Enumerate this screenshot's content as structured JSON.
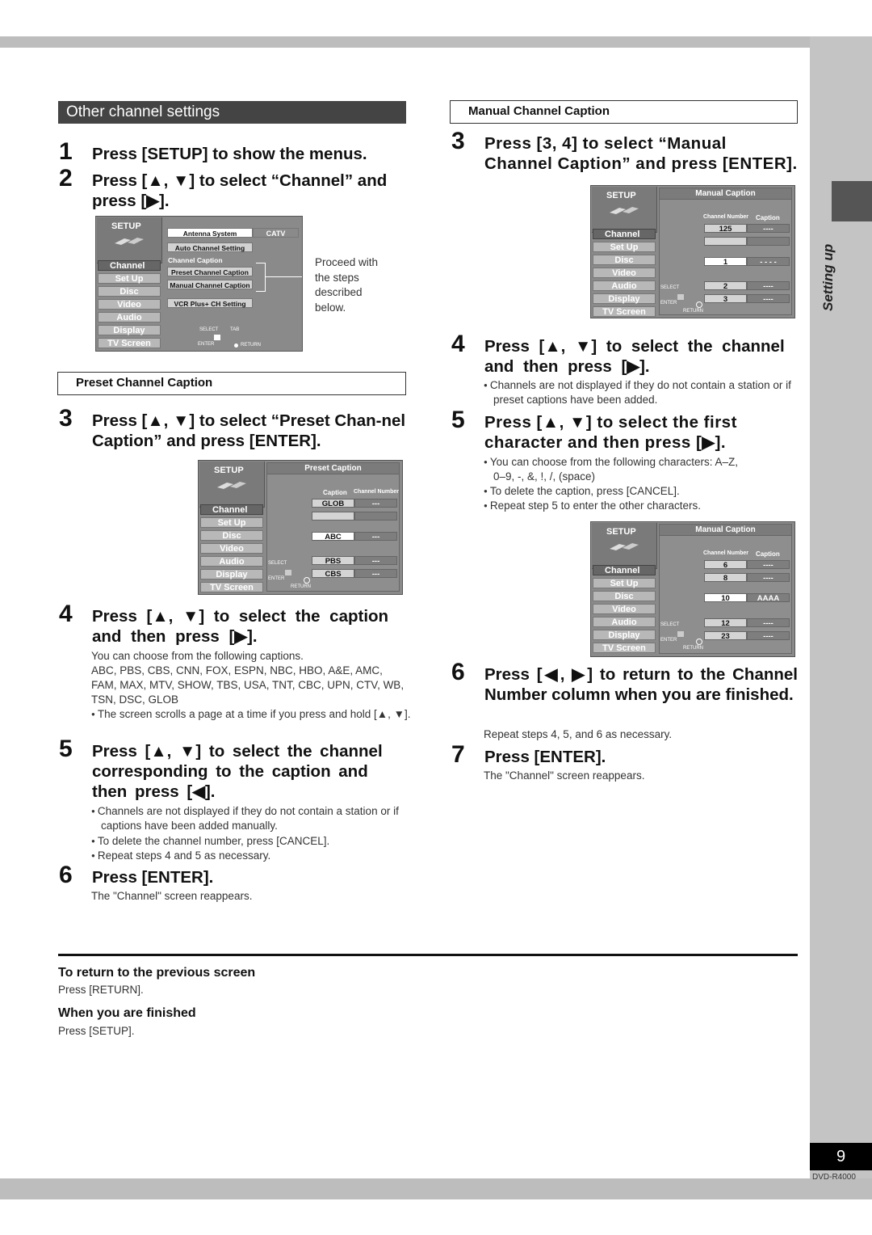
{
  "page": {
    "side_label": "Setting up",
    "page_number": "9",
    "model": "DVD-R4000"
  },
  "left": {
    "section_title": "Other channel settings",
    "steps_intro": [
      {
        "n": "1",
        "text": "Press [SETUP] to show the menus."
      },
      {
        "n": "2",
        "text": "Press [▲, ▼] to select “Channel” and press [▶]."
      }
    ],
    "proceed_note": "Proceed with the steps described below.",
    "preset_box": "Preset Channel Caption",
    "step3": {
      "n": "3",
      "text": "Press [▲, ▼] to select “Preset Chan-nel Caption” and press [ENTER]."
    },
    "step4": {
      "n": "4",
      "text": "Press [▲, ▼] to select the caption and then press [▶].",
      "lead": "You can choose from the following captions.",
      "captions": "ABC, PBS, CBS, CNN, FOX, ESPN, NBC, HBO, A&E, AMC, FAM, MAX, MTV, SHOW, TBS, USA, TNT, CBC, UPN, CTV, WB, TSN, DSC, GLOB",
      "bullet": "The screen scrolls a page at a time if you press and hold [▲, ▼]."
    },
    "step5": {
      "n": "5",
      "text": "Press [▲, ▼] to select the channel corresponding to the caption and then press [◀].",
      "bullets": [
        "Channels are not displayed if they do not contain a station or if captions have been added manually.",
        "To delete the channel number, press [CANCEL].",
        "Repeat steps 4 and 5 as necessary."
      ]
    },
    "step6": {
      "n": "6",
      "text": "Press [ENTER].",
      "note": "The \"Channel\" screen reappears."
    }
  },
  "right": {
    "manual_box": "Manual Channel Caption",
    "step3": {
      "n": "3",
      "text": "Press [3, 4] to select “Manual Channel Caption” and press [ENTER]."
    },
    "step4": {
      "n": "4",
      "text": "Press [▲, ▼] to select the channel and then press [▶].",
      "bullet": "Channels are not displayed if they do not contain a station or if preset captions have been added."
    },
    "step5": {
      "n": "5",
      "text": "Press [▲, ▼] to select the first character and then press [▶].",
      "bullets": [
        "You can choose from the following characters: A–Z, 0–9, -, &, !, /, (space)",
        "To delete the caption, press [CANCEL].",
        "Repeat step 5 to enter the other characters."
      ]
    },
    "step6": {
      "n": "6",
      "text": "Press [◀, ▶] to return to the Channel Number column when you are finished.",
      "note": "Repeat steps 4, 5, and 6 as necessary."
    },
    "step7": {
      "n": "7",
      "text": "Press [ENTER].",
      "note": "The \"Channel\" screen reappears."
    }
  },
  "footer": {
    "h1": "To return to the previous screen",
    "p1": "Press [RETURN].",
    "h2": "When you are finished",
    "p2": "Press [SETUP]."
  },
  "osd_common": {
    "setup": "SETUP",
    "menu": [
      "Channel",
      "Set Up",
      "Disc",
      "Video",
      "Audio",
      "Display",
      "TV Screen"
    ],
    "select": "SELECT",
    "enter": "ENTER",
    "tab": "TAB",
    "return": "RETURN"
  },
  "osd_channel": {
    "antenna_label": "Antenna System",
    "antenna_value": "CATV",
    "auto": "Auto Channel Setting",
    "caption_label": "Channel Caption",
    "preset": "Preset Channel Caption",
    "manual": "Manual Channel Caption",
    "vcrplus": "VCR Plus+ CH Setting"
  },
  "osd_preset": {
    "title": "Preset Caption",
    "col1": "Caption",
    "col2": "Channel Number",
    "rows": [
      [
        "GLOB",
        "---"
      ],
      [
        "",
        ""
      ],
      [
        "ABC",
        "---"
      ],
      [
        "PBS",
        "---"
      ],
      [
        "CBS",
        "---"
      ]
    ]
  },
  "osd_manual1": {
    "title": "Manual Caption",
    "col1": "Channel Number",
    "col2": "Caption",
    "rows": [
      [
        "125",
        "----"
      ],
      [
        "",
        ""
      ],
      [
        "1",
        "- - - -"
      ],
      [
        "2",
        "----"
      ],
      [
        "3",
        "----"
      ]
    ]
  },
  "osd_manual2": {
    "title": "Manual Caption",
    "col1": "Channel Number",
    "col2": "Caption",
    "rows": [
      [
        "6",
        "----"
      ],
      [
        "8",
        "----"
      ],
      [
        "10",
        "AAAA"
      ],
      [
        "12",
        "----"
      ],
      [
        "23",
        "----"
      ]
    ]
  }
}
